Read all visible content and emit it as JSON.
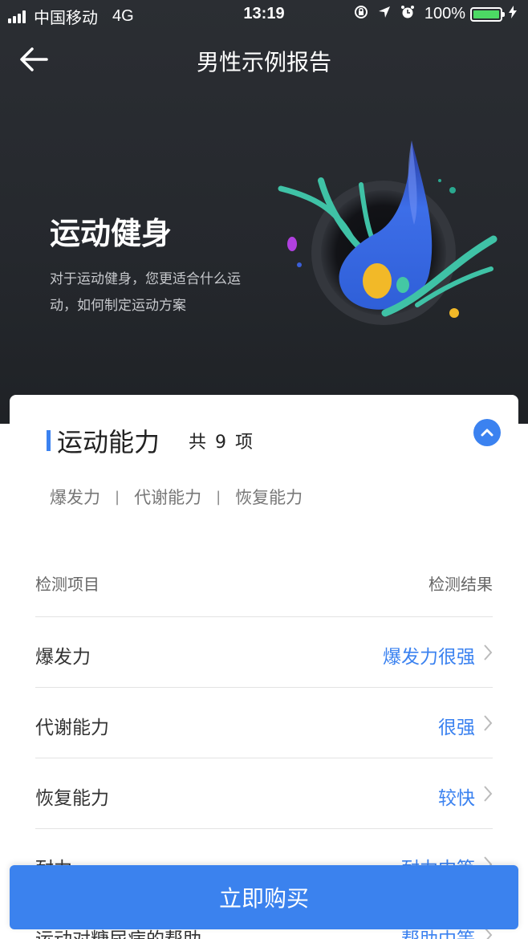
{
  "status_bar": {
    "carrier": "中国移动",
    "network": "4G",
    "time": "13:19",
    "battery": "100%",
    "battery_level": 1.0
  },
  "nav": {
    "title": "男性示例报告"
  },
  "hero": {
    "title": "运动健身",
    "description": "对于运动健身，您更适合什么运动，如何制定运动方案"
  },
  "section": {
    "title": "运动能力",
    "count_label": "共 9 项",
    "tags": [
      "爆发力",
      "代谢能力",
      "恢复能力"
    ],
    "separator": "|"
  },
  "table": {
    "header_left": "检测项目",
    "header_right": "检测结果",
    "rows": [
      {
        "label": "爆发力",
        "value": "爆发力很强"
      },
      {
        "label": "代谢能力",
        "value": "很强"
      },
      {
        "label": "恢复能力",
        "value": "较快"
      },
      {
        "label": "耐力",
        "value": "耐力中等"
      },
      {
        "label": "运动对糖尿病的帮助",
        "value": "帮助中等"
      }
    ]
  },
  "buy_button": {
    "label": "立即购买"
  },
  "colors": {
    "accent": "#3b82f0",
    "hero_bg": "#2b2e33",
    "battery_green": "#4cd964"
  },
  "icons": {
    "back": "arrow-left-icon",
    "collapse": "chevron-up-icon",
    "row": "chevron-right-icon"
  }
}
